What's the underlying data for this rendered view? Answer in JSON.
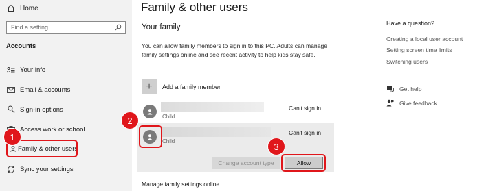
{
  "sidebar": {
    "home_label": "Home",
    "search_placeholder": "Find a setting",
    "section_title": "Accounts",
    "items": [
      {
        "label": "Your info",
        "icon": "user-list-icon"
      },
      {
        "label": "Email & accounts",
        "icon": "mail-icon"
      },
      {
        "label": "Sign-in options",
        "icon": "key-icon"
      },
      {
        "label": "Access work or school",
        "icon": "briefcase-icon"
      },
      {
        "label": "Family & other users",
        "icon": "people-icon"
      },
      {
        "label": "Sync your settings",
        "icon": "sync-icon"
      }
    ]
  },
  "main": {
    "page_title": "Family & other users",
    "sub_title": "Your family",
    "description": "You can allow family members to sign in to this PC. Adults can manage family settings online and see recent activity to help kids stay safe.",
    "add_member_label": "Add a family member",
    "members": [
      {
        "role": "Child",
        "status": "Can't sign in"
      },
      {
        "role": "Child",
        "status": "Can't sign in"
      }
    ],
    "change_account_type_label": "Change account type",
    "allow_label": "Allow",
    "manage_link": "Manage family settings online"
  },
  "right": {
    "question_title": "Have a question?",
    "links": [
      "Creating a local user account",
      "Setting screen time limits",
      "Switching users"
    ],
    "help": [
      {
        "label": "Get help",
        "icon": "chat-help-icon"
      },
      {
        "label": "Give feedback",
        "icon": "feedback-icon"
      }
    ]
  },
  "annotations": {
    "step1": "1",
    "step2": "2",
    "step3": "3",
    "highlight_color": "#e0161b"
  }
}
